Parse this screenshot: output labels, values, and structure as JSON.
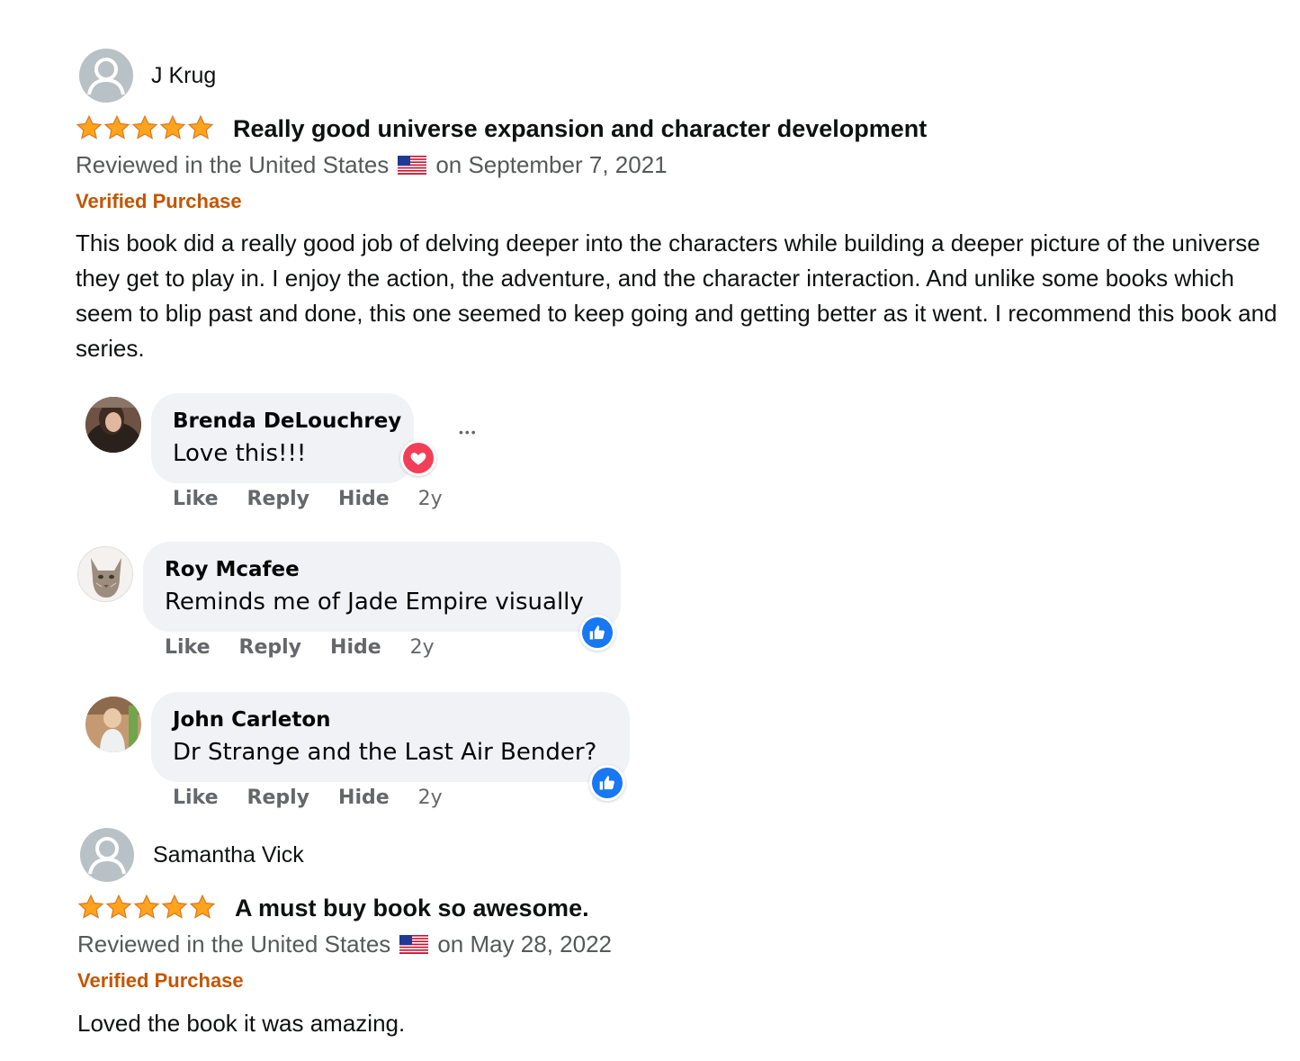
{
  "colors": {
    "star": "#ffa41c",
    "verified": "#c45500",
    "meta_gray": "#565959",
    "bubble_bg": "#f0f2f5",
    "like_blue": "#1877f2",
    "love_red": "#f33e58"
  },
  "reviews": [
    {
      "reviewer": "J Krug",
      "rating": 5,
      "title": "Really good universe expansion and character development",
      "meta_prefix": "Reviewed in the United States",
      "flag": "us-flag-icon",
      "meta_suffix": "on September 7, 2021",
      "verified": "Verified Purchase",
      "body": "This book did a really good job of delving deeper into the characters while building a deeper picture of the universe they get to play in. I enjoy the action, the adventure, and the character interaction. And unlike some books which seem to blip past and done, this one seemed to keep going and getting better as it went. I recommend this book and series."
    },
    {
      "reviewer": "Samantha Vick",
      "rating": 5,
      "title": "A must buy book so awesome.",
      "meta_prefix": "Reviewed in the United States",
      "flag": "us-flag-icon",
      "meta_suffix": "on May 28, 2022",
      "verified": "Verified Purchase",
      "body": "Loved the book it was amazing."
    }
  ],
  "comments": [
    {
      "name": "Brenda DeLouchrey",
      "text": "Love this!!!",
      "reaction": "heart-icon",
      "actions": [
        "Like",
        "Reply",
        "Hide"
      ],
      "time": "2y",
      "more": "•••"
    },
    {
      "name": "Roy Mcafee",
      "text": "Reminds me of Jade Empire visually",
      "reaction": "thumbs-up-icon",
      "actions": [
        "Like",
        "Reply",
        "Hide"
      ],
      "time": "2y"
    },
    {
      "name": "John Carleton",
      "text": "Dr Strange and the Last Air Bender?",
      "reaction": "thumbs-up-icon",
      "actions": [
        "Like",
        "Reply",
        "Hide"
      ],
      "time": "2y"
    }
  ]
}
